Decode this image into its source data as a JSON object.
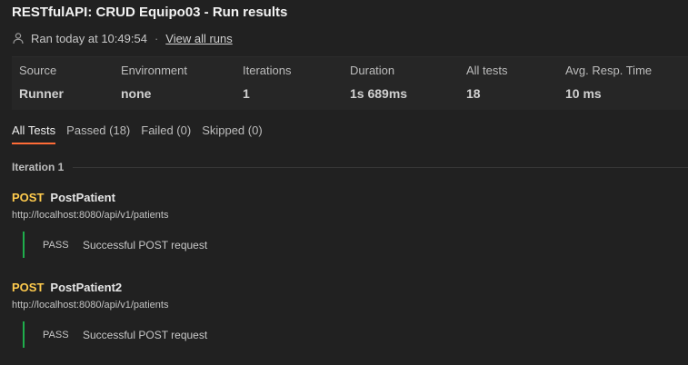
{
  "page": {
    "title": "RESTfulAPI: CRUD Equipo03 - Run results",
    "ran_text": "Ran today at 10:49:54",
    "separator": "·",
    "view_all_runs": "View all runs"
  },
  "summary": [
    {
      "label": "Source",
      "value": "Runner"
    },
    {
      "label": "Environment",
      "value": "none"
    },
    {
      "label": "Iterations",
      "value": "1"
    },
    {
      "label": "Duration",
      "value": "1s 689ms"
    },
    {
      "label": "All tests",
      "value": "18"
    },
    {
      "label": "Avg. Resp. Time",
      "value": "10 ms"
    }
  ],
  "tabs": [
    {
      "label": "All Tests",
      "active": true
    },
    {
      "label": "Passed (18)"
    },
    {
      "label": "Failed (0)"
    },
    {
      "label": "Skipped (0)"
    }
  ],
  "iteration_label": "Iteration 1",
  "requests": [
    {
      "method": "POST",
      "name": "PostPatient",
      "url": "http://localhost:8080/api/v1/patients",
      "results": [
        {
          "status": "PASS",
          "message": "Successful POST request"
        }
      ]
    },
    {
      "method": "POST",
      "name": "PostPatient2",
      "url": "http://localhost:8080/api/v1/patients",
      "results": [
        {
          "status": "PASS",
          "message": "Successful POST request"
        }
      ]
    }
  ],
  "colors": {
    "background": "#212121",
    "accent": "#ff6c37",
    "method_post": "#ffcb4d",
    "pass": "#1fae4c"
  },
  "icons": {
    "user": "user-icon"
  }
}
